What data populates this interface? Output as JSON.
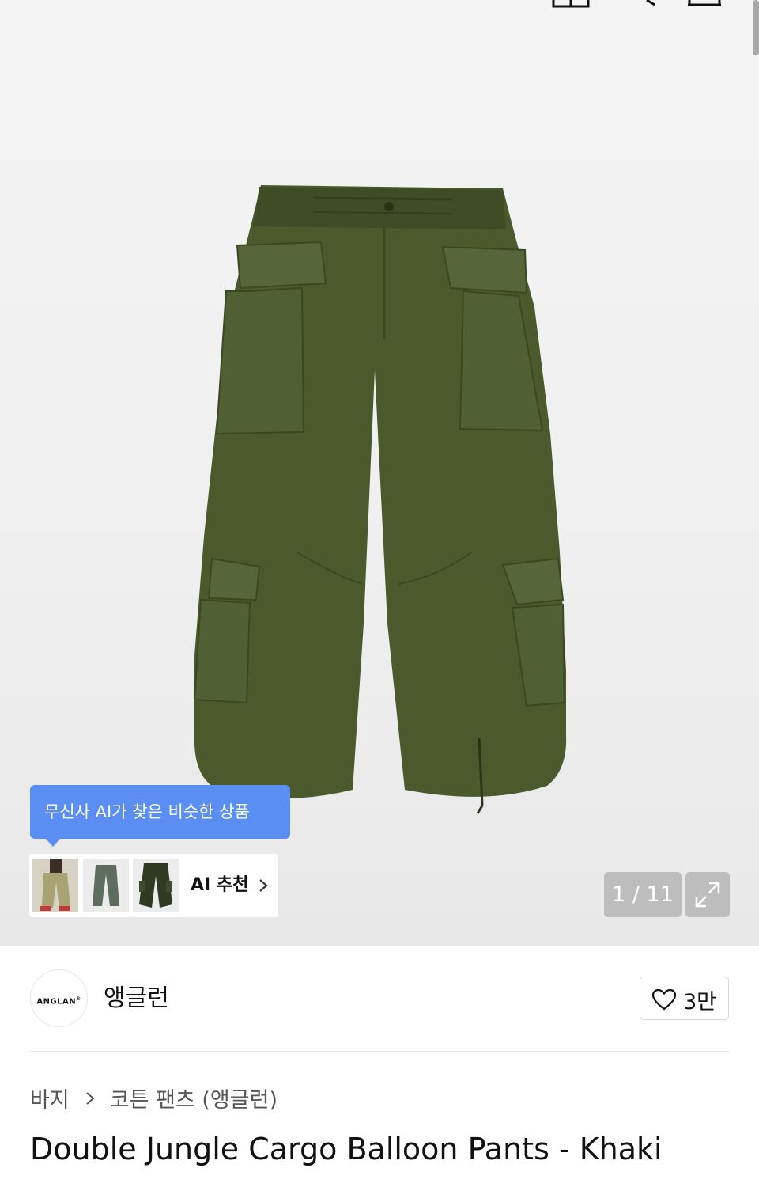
{
  "top_bar": {
    "icons": [
      "back-icon",
      "closet-icon",
      "search-icon",
      "cart-icon"
    ]
  },
  "gallery": {
    "image_alt": "Double Jungle Cargo Balloon Pants - Khaki",
    "page_counter": "1 / 11",
    "expand_icon": "expand-icon"
  },
  "ai_recommend": {
    "tooltip": "무신사 AI가 찾은 비슷한 상품",
    "link_label": "AI 추천",
    "thumbnails": [
      "thumb-beige-pants-model",
      "thumb-grey-green-pants",
      "thumb-dark-cargo-pants"
    ]
  },
  "brand": {
    "logo_text": "ANGLAN",
    "name": "앵글런",
    "like_count": "3만"
  },
  "breadcrumb": {
    "category": "바지",
    "subcategory": "코튼 팬츠 (앵글런)"
  },
  "product": {
    "title": "Double Jungle Cargo Balloon Pants - Khaki"
  },
  "colors": {
    "accent_blue": "#5b8ef2",
    "pants_khaki": "#4a5a2c",
    "counter_bg": "#bdbdbd"
  }
}
